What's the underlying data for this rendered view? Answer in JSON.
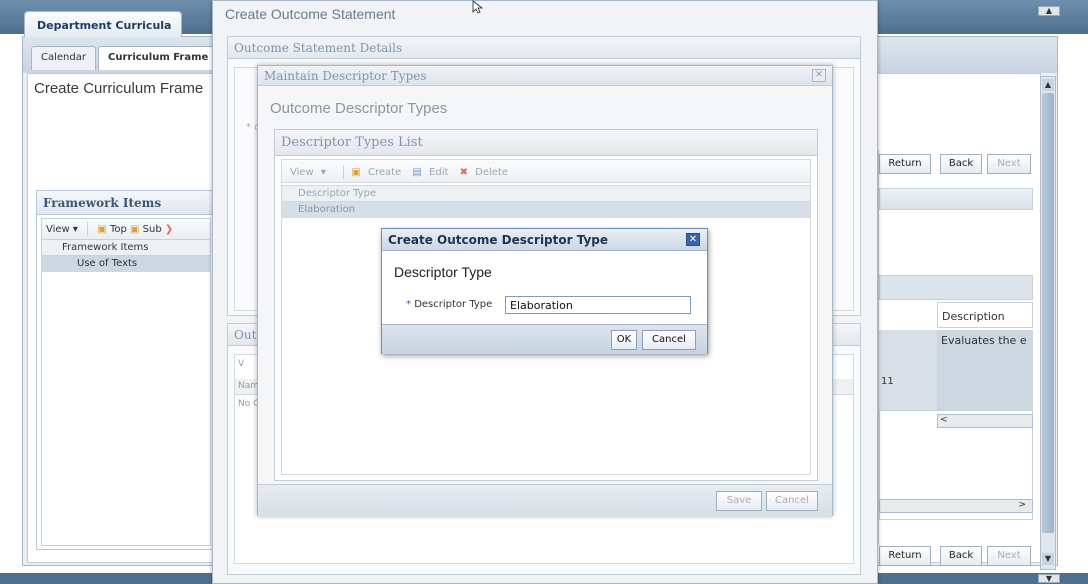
{
  "app": {
    "tab": "Department Curricula",
    "subtabs": [
      "Calendar",
      "Curriculum Frame"
    ],
    "page_title": "Create Curriculum Frame"
  },
  "framework": {
    "title": "Framework Items",
    "toolbar": {
      "view": "View",
      "top": "Top",
      "sub": "Sub"
    },
    "column": "Framework Items",
    "rows": [
      "Use of Texts"
    ]
  },
  "right": {
    "top_buttons": {
      "return": "Return",
      "back": "Back",
      "next": "Next"
    },
    "column": "Description",
    "cell": "Evaluates the e",
    "number": "11",
    "bottom_buttons": {
      "return": "Return",
      "back": "Back",
      "next": "Next"
    }
  },
  "outcome_statement": {
    "title": "Create Outcome Statement",
    "details_title": "Outcome Statement Details",
    "required_mark": "* c",
    "outcomes_title": "Out",
    "grid_view": "V",
    "grid_header": "Nam",
    "grid_empty": "No C"
  },
  "maintain": {
    "title": "Maintain Descriptor Types",
    "heading": "Outcome Descriptor Types",
    "list_title": "Descriptor Types List",
    "toolbar": {
      "view": "View",
      "create": "Create",
      "edit": "Edit",
      "delete": "Delete"
    },
    "column": "Descriptor Type",
    "rows": [
      "Elaboration"
    ],
    "save": "Save",
    "cancel": "Cancel"
  },
  "dialog": {
    "title": "Create Outcome Descriptor Type",
    "heading": "Descriptor Type",
    "field_label": "Descriptor Type",
    "field_value": "Elaboration",
    "ok": "OK",
    "cancel": "Cancel"
  },
  "icons": {
    "close": "close-icon",
    "dropdown": "chevron-down-icon",
    "create": "create-icon",
    "edit": "edit-icon",
    "delete": "delete-icon"
  },
  "colors": {
    "accent": "#3a64a8",
    "selection": "#ccd7e2",
    "header_bar": "#4f6f8f"
  }
}
